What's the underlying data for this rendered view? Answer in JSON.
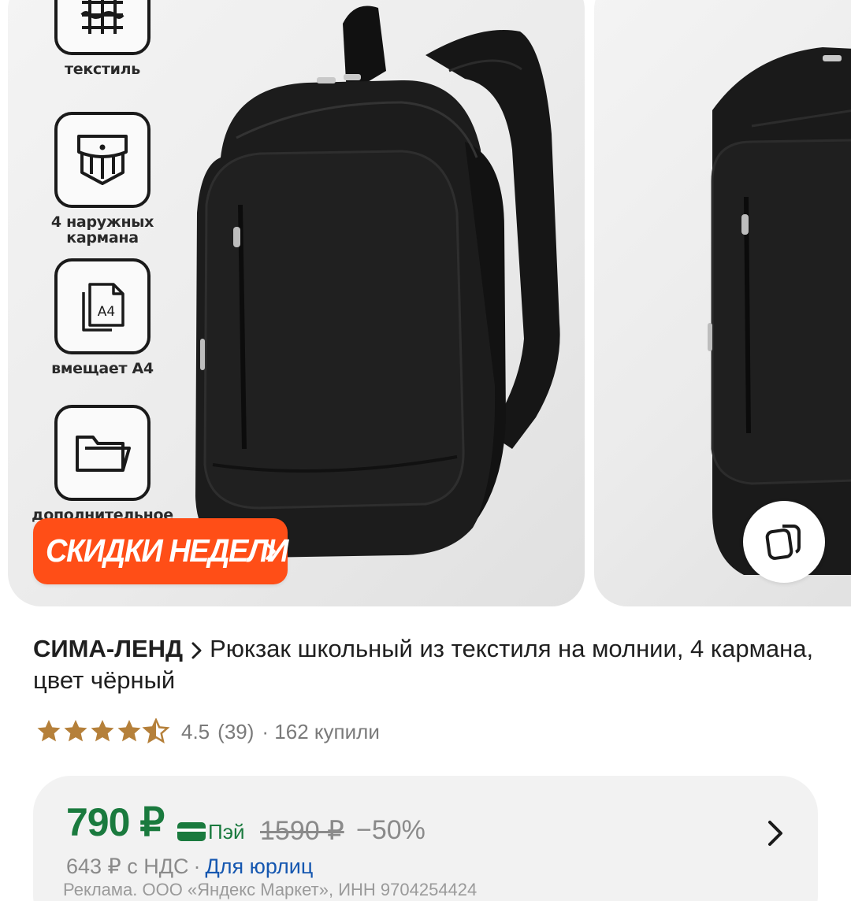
{
  "gallery": {
    "features": [
      {
        "icon": "textile-icon",
        "label": "текстиль"
      },
      {
        "icon": "pocket-icon",
        "label": "4 наружных кармана"
      },
      {
        "icon": "a4-documents-icon",
        "label": "вмещает А4",
        "icon_text": "А4"
      },
      {
        "icon": "folder-icon",
        "label": "дополнительное"
      }
    ],
    "promo_label": "СКИДКИ НЕДЕЛИ",
    "promo_color": "#ff4e17"
  },
  "product": {
    "brand": "СИМА-ЛЕНД",
    "title": "Рюкзак школьный из текстиля на молнии, 4 кармана, цвет чёрный",
    "rating": "4.5",
    "rating_value": 4.5,
    "reviews": "(39)",
    "purchases": "· 162 купили"
  },
  "price": {
    "current": "790 ₽",
    "pay_label": "Пэй",
    "old": "1590 ₽",
    "discount": "−50%",
    "vat_price": "643 ₽ с НДС",
    "vat_separator": "·",
    "business_link": "Для юрлиц",
    "ad_note": "Реклама. ООО «Яндекс Маркет», ИНН 9704254424",
    "accent_color": "#1a7a3e"
  }
}
